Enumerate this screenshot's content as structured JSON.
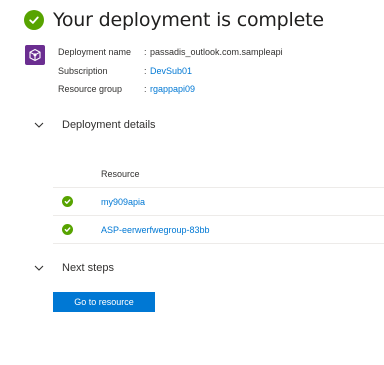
{
  "header": {
    "title": "Your deployment is complete",
    "status_color": "#57a300"
  },
  "resource_icon": {
    "name": "cube-icon",
    "color": "#6b2e91"
  },
  "deployment_info": [
    {
      "label": "Deployment name",
      "value": "passadis_outlook.com.sampleapi",
      "is_link": false
    },
    {
      "label": "Subscription",
      "value": "DevSub01",
      "is_link": true
    },
    {
      "label": "Resource group",
      "value": "rgappapi09",
      "is_link": true
    }
  ],
  "separator": ":",
  "sections": {
    "deployment_details": "Deployment details",
    "next_steps": "Next steps"
  },
  "resources_table": {
    "column_header": "Resource",
    "rows": [
      {
        "name": "my909apia",
        "status": "succeeded"
      },
      {
        "name": "ASP-eerwerfwegroup-83bb",
        "status": "succeeded"
      }
    ]
  },
  "actions": {
    "go_to_resource": "Go to resource"
  },
  "colors": {
    "link": "#0078d4",
    "primary_button": "#0078d4"
  }
}
